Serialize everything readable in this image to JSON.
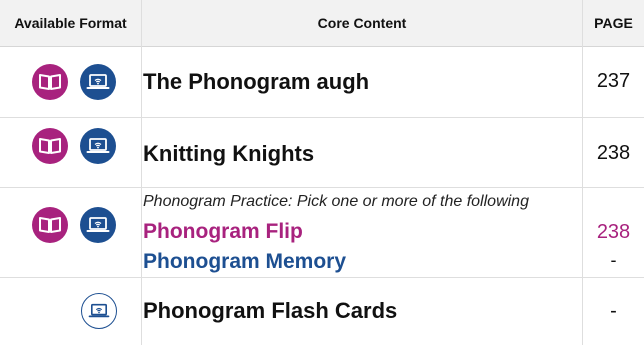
{
  "header": {
    "format_label": "Available Format",
    "content_label": "Core Content",
    "page_label": "PAGE"
  },
  "rows": [
    {
      "formats": [
        "book-icon",
        "laptop-icon"
      ],
      "title": "The Phonogram augh",
      "page": "237"
    },
    {
      "formats": [
        "book-icon",
        "laptop-icon"
      ],
      "title": "Knitting Knights",
      "page": "238"
    },
    {
      "formats": [
        "book-icon",
        "laptop-icon"
      ],
      "note": "Phonogram Practice: Pick one or more of the following",
      "options": [
        {
          "title": "Phonogram Flip",
          "page": "238",
          "color": "#a8227e"
        },
        {
          "title": "Phonogram Memory",
          "page": "-",
          "color": "#1d4f91"
        }
      ]
    },
    {
      "formats": [
        "laptop-icon"
      ],
      "title": "Phonogram Flash Cards",
      "page": "-"
    }
  ],
  "colors": {
    "book_format": "#a8227e",
    "digital_format": "#1d4f91"
  }
}
